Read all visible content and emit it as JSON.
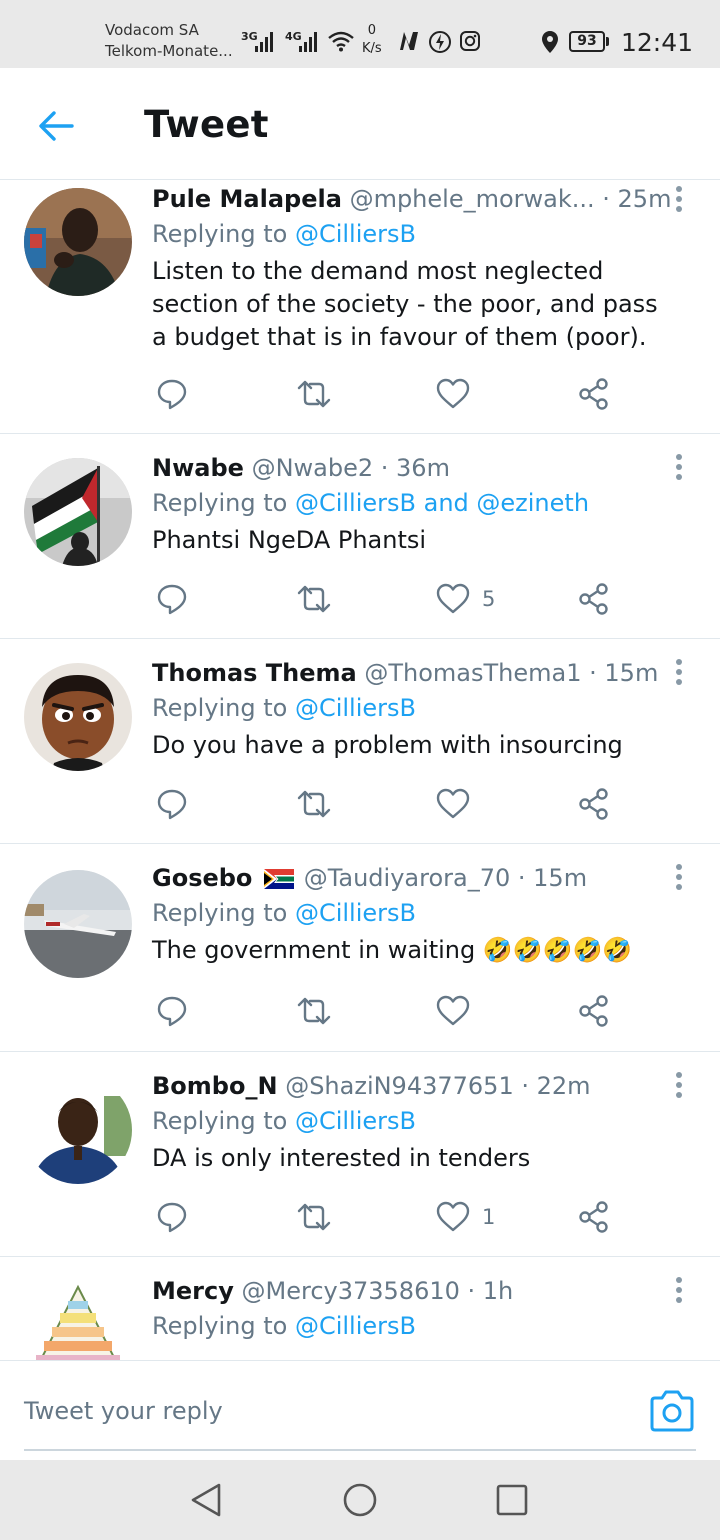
{
  "status_bar": {
    "carrier_1": "Vodacom SA",
    "carrier_2": "Telkom-Monate...",
    "net_1": "3G",
    "net_2": "4G",
    "speed_value": "0",
    "speed_unit": "K/s",
    "battery": "93",
    "time": "12:41"
  },
  "header": {
    "title": "Tweet"
  },
  "tweets": [
    {
      "name": "Pule Malapela",
      "handle": "@mphele_morwak...",
      "time": "· 25m",
      "replying_prefix": "Replying to",
      "mentions": "@CilliersB",
      "text": "Listen to the demand most neglected section of the society - the poor, and pass a budget that is in favour of them (poor).",
      "likes": ""
    },
    {
      "name": "Nwabe",
      "handle": "@Nwabe2",
      "time": "· 36m",
      "replying_prefix": "Replying to",
      "mentions": "@CilliersB and @ezineth",
      "text": "Phantsi NgeDA Phantsi",
      "likes": "5"
    },
    {
      "name": "Thomas Thema",
      "handle": "@ThomasThema1",
      "time": "· 15m",
      "replying_prefix": "Replying to",
      "mentions": "@CilliersB",
      "text": "Do you have a problem with insourcing",
      "likes": ""
    },
    {
      "name": "Gosebo",
      "handle": "@Taudiyarora_70",
      "time": "· 15m",
      "replying_prefix": "Replying to",
      "mentions": "@CilliersB",
      "text": "The government in waiting 🤣🤣🤣🤣🤣",
      "likes": ""
    },
    {
      "name": "Bombo_N",
      "handle": "@ShaziN94377651",
      "time": "· 22m",
      "replying_prefix": "Replying to",
      "mentions": "@CilliersB",
      "text": "DA is only interested in tenders",
      "likes": "1"
    },
    {
      "name": "Mercy",
      "handle": "@Mercy37358610",
      "time": "· 1h",
      "replying_prefix": "Replying to",
      "mentions": "@CilliersB",
      "text": "",
      "likes": ""
    }
  ],
  "reply_bar": {
    "placeholder": "Tweet your reply"
  },
  "icons": {
    "back": "arrow-left-icon",
    "more": "more-vertical-icon",
    "reply": "reply-icon",
    "retweet": "retweet-icon",
    "like": "heart-icon",
    "share": "share-icon",
    "camera": "camera-icon"
  },
  "colors": {
    "accent": "#1da1f2",
    "text": "#14171a",
    "muted": "#657786",
    "divider": "#e1e8ed"
  }
}
